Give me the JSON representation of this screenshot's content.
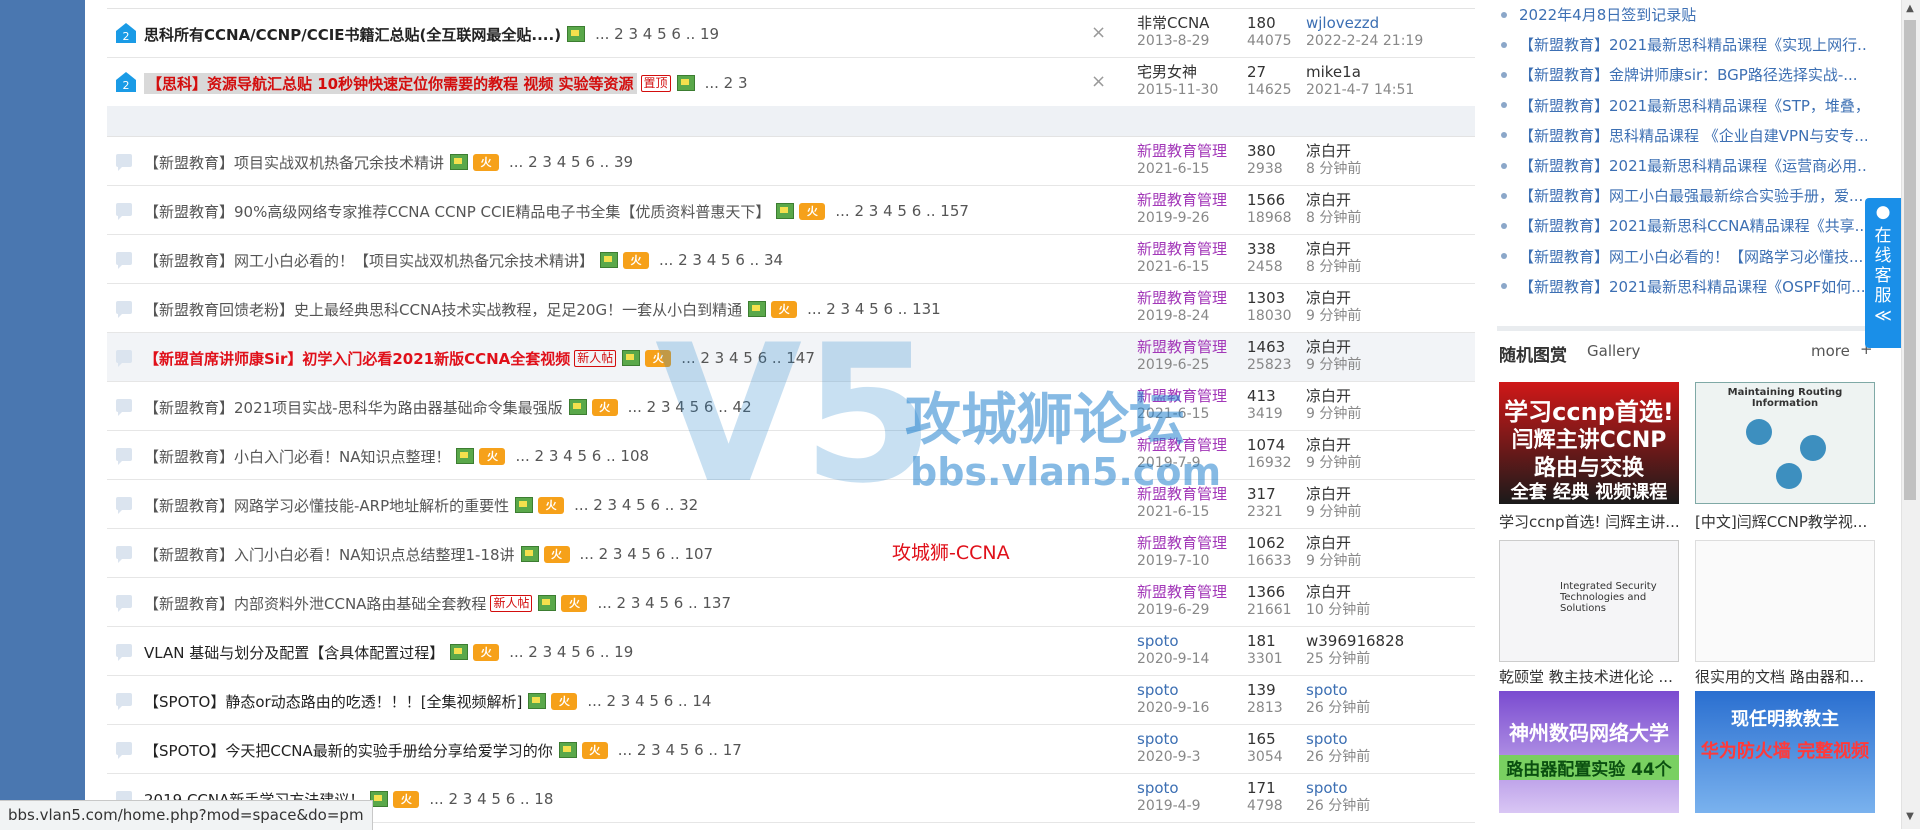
{
  "sticky": [
    {
      "title": "思科所有CCNA/CCNP/CCIE书籍汇总贴(全互联网最全贴....)",
      "pages": "... 2  3  4  5  6 .. 19",
      "author": "非常CCNA",
      "date": "2013-8-29",
      "replies": "180",
      "views": "44075",
      "last_user": "wjlovezzd",
      "last_time": "2022-2-24 21:19"
    },
    {
      "title": "【思科】资源导航汇总贴 10秒钟快速定位你需要的教程 视频 实验等资源",
      "badge": "置顶",
      "pages": "... 2  3",
      "author": "宅男女神",
      "date": "2015-11-30",
      "replies": "27",
      "views": "14625",
      "last_user": "mike1a",
      "last_time": "2021-4-7 14:51"
    }
  ],
  "threads": [
    {
      "title": "【新盟教育】项目实战双机热备冗余技术精讲",
      "pages": "... 2  3  4  5  6 .. 39",
      "author": "新盟教育管理",
      "date": "2021-6-15",
      "replies": "380",
      "views": "2938",
      "last_user": "凉白开",
      "last_time": "8 分钟前"
    },
    {
      "title": "【新盟教育】90%高级网络专家推荐CCNA CCNP CCIE精品电子书全集【优质资料普惠天下】",
      "pages": "... 2  3  4  5  6 .. 157",
      "author": "新盟教育管理",
      "date": "2019-9-26",
      "replies": "1566",
      "views": "18968",
      "last_user": "凉白开",
      "last_time": "8 分钟前"
    },
    {
      "title": "【新盟教育】网工小白必看的！【项目实战双机热备冗余技术精讲】",
      "pages": "... 2  3  4  5  6 .. 34",
      "author": "新盟教育管理",
      "date": "2021-6-15",
      "replies": "338",
      "views": "2458",
      "last_user": "凉白开",
      "last_time": "8 分钟前"
    },
    {
      "title": "【新盟教育回馈老粉】史上最经典思科CCNA技术实战教程，足足20G！一套从小白到精通",
      "pages": "... 2  3  4  5  6 .. 131",
      "author": "新盟教育管理",
      "date": "2019-8-24",
      "replies": "1303",
      "views": "18030",
      "last_user": "凉白开",
      "last_time": "9 分钟前"
    },
    {
      "title": "【新盟首席讲师康Sir】初学入门必看2021新版CCNA全套视频",
      "badge": "新人帖",
      "pages": "... 2  3  4  5  6 .. 147",
      "author": "新盟教育管理",
      "date": "2019-6-25",
      "replies": "1463",
      "views": "25823",
      "last_user": "凉白开",
      "last_time": "9 分钟前"
    },
    {
      "title": "【新盟教育】2021项目实战-思科华为路由器基础命令集最强版",
      "pages": "... 2  3  4  5  6 .. 42",
      "author": "新盟教育管理",
      "date": "2021-6-15",
      "replies": "413",
      "views": "3419",
      "last_user": "凉白开",
      "last_time": "9 分钟前"
    },
    {
      "title": "【新盟教育】小白入门必看！NA知识点整理！",
      "pages": "... 2  3  4  5  6 .. 108",
      "author": "新盟教育管理",
      "date": "2019-7-9",
      "replies": "1074",
      "views": "16932",
      "last_user": "凉白开",
      "last_time": "9 分钟前"
    },
    {
      "title": "【新盟教育】网路学习必懂技能-ARP地址解析的重要性",
      "pages": "... 2  3  4  5  6 .. 32",
      "author": "新盟教育管理",
      "date": "2021-6-15",
      "replies": "317",
      "views": "2321",
      "last_user": "凉白开",
      "last_time": "9 分钟前"
    },
    {
      "title": "【新盟教育】入门小白必看！NA知识点总结整理1-18讲",
      "pages": "... 2  3  4  5  6 .. 107",
      "author": "新盟教育管理",
      "date": "2019-7-10",
      "replies": "1062",
      "views": "16633",
      "last_user": "凉白开",
      "last_time": "9 分钟前"
    },
    {
      "title": "【新盟教育】内部资料外泄CCNA路由基础全套教程",
      "badge": "新人帖",
      "pages": "... 2  3  4  5  6 .. 137",
      "author": "新盟教育管理",
      "date": "2019-6-29",
      "replies": "1366",
      "views": "21661",
      "last_user": "凉白开",
      "last_time": "10 分钟前"
    },
    {
      "title": "VLAN 基础与划分及配置【含具体配置过程】",
      "pages": "... 2  3  4  5  6 .. 19",
      "author": "spoto",
      "date": "2020-9-14",
      "replies": "181",
      "views": "3301",
      "last_user": "w396916828",
      "last_time": "25 分钟前"
    },
    {
      "title": "【SPOTO】静态or动态路由的吃透！！！[全集视频解析]",
      "pages": "... 2  3  4  5  6 .. 14",
      "author": "spoto",
      "date": "2020-9-16",
      "replies": "139",
      "views": "2813",
      "last_user": "spoto",
      "last_time": "26 分钟前"
    },
    {
      "title": "【SPOTO】今天把CCNA最新的实验手册给分享给爱学习的你",
      "pages": "... 2  3  4  5  6 .. 17",
      "author": "spoto",
      "date": "2020-9-3",
      "replies": "165",
      "views": "3054",
      "last_user": "spoto",
      "last_time": "26 分钟前"
    },
    {
      "title": "2019 CCNA新手学习方法建议！",
      "pages": "... 2  3  4  5  6 .. 18",
      "author": "spoto",
      "date": "2019-4-9",
      "replies": "171",
      "views": "4798",
      "last_user": "spoto",
      "last_time": "26 分钟前"
    }
  ],
  "sidebar": {
    "items": [
      "2022年4月8日签到记录贴",
      "【新盟教育】2021最新思科精品课程《实现上网行...",
      "【新盟教育】金牌讲师康sir：BGP路径选择实战-...",
      "【新盟教育】2021最新思科精品课程《STP，堆叠，...",
      "【新盟教育】思科精品课程 《企业自建VPN与安专...",
      "【新盟教育】2021最新思科精品课程《运营商必用...",
      "【新盟教育】网工小白最强最新综合实验手册，爱...",
      "【新盟教育】2021最新思科CCNA精品课程《共享...",
      "【新盟教育】网工小白必看的！【网路学习必懂技...",
      "【新盟教育】2021最新思科精品课程《OSPF如何..."
    ],
    "gallery_title": "随机图赏",
    "gallery_sub": "Gallery",
    "more": "more",
    "plus": "+",
    "gallery": [
      {
        "text1": "学习ccnp首选!",
        "text2": "闫辉主讲CCNP",
        "text3": "路由与交换",
        "text4": "全套 经典 视频课程",
        "caption": "学习ccnp首选! 闫辉主讲..."
      },
      {
        "text1": "Maintaining Routing Information",
        "caption": "[中文]闫辉CCNP教学视..."
      },
      {
        "text1": "Integrated Security Technologies and Solutions",
        "caption": "乾颐堂 教主技术进化论 ..."
      },
      {
        "text1": "",
        "caption": "很实用的文档 路由器和..."
      },
      {
        "text1": "神州数码网络大学",
        "text2": "路由器配置实验 44个",
        "caption": ""
      },
      {
        "text1": "现任明教教主",
        "text2": "华为防火墙 完整视频",
        "caption": ""
      }
    ]
  },
  "service": {
    "label": "在线客服",
    "arrow": "≪"
  },
  "watermark": {
    "brand": "攻城狮论坛",
    "url": "bbs.vlan5.com",
    "red": "攻城狮-CCNA"
  },
  "status_url": "bbs.vlan5.com/home.php?mod=space&do=pm",
  "icons": {
    "hot": "火",
    "close": "×"
  }
}
